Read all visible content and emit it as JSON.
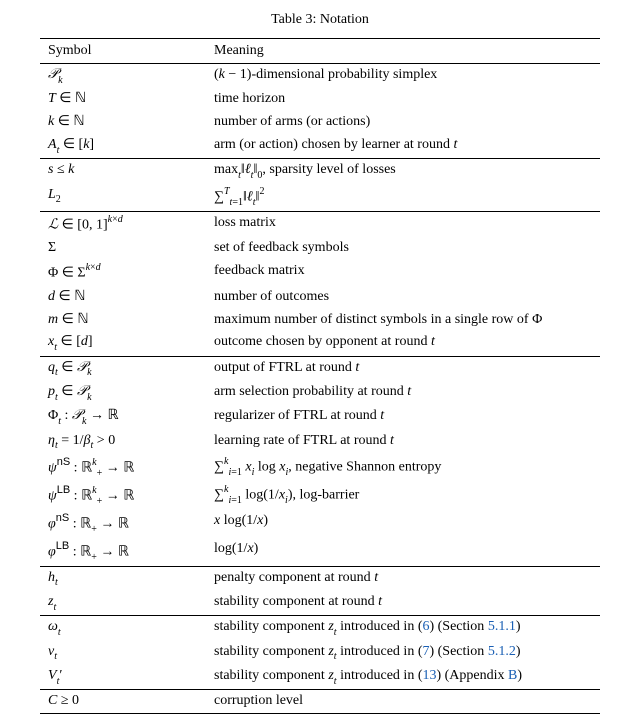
{
  "caption": "Table 3:  Notation",
  "header": {
    "symbol": "Symbol",
    "meaning": "Meaning"
  },
  "groups": [
    [
      {
        "sym": "<span class='cal'>𝒫</span><span class='sub'><span class='math'>k</span></span>",
        "mean": "(<span class='math'>k</span> − 1)-dimensional probability simplex"
      },
      {
        "sym": "<span class='math'>T</span> ∈ <span class='bb'>ℕ</span>",
        "mean": "time horizon"
      },
      {
        "sym": "<span class='math'>k</span> ∈ <span class='bb'>ℕ</span>",
        "mean": "number of arms (or actions)"
      },
      {
        "sym": "<span class='math'>A</span><span class='sub'><span class='math'>t</span></span> ∈ [<span class='math'>k</span>]",
        "mean": "arm (or action) chosen by learner at round <span class='math'>t</span>"
      }
    ],
    [
      {
        "sym": "<span class='math'>s</span> ≤ <span class='math'>k</span>",
        "mean": "max<span class='sub'><span class='math'>t</span></span>‖<span class='math'>ℓ</span><span class='sub'><span class='math'>t</span></span>‖<span class='sub'>0</span>, sparsity level of losses"
      },
      {
        "sym": "<span class='math'>L</span><span class='sub'>2</span>",
        "mean": "∑<span class='sup'><span class='math'>T</span></span><span class='sub'><span class='math'>t</span>=1</span>‖<span class='math'>ℓ</span><span class='sub'><span class='math'>t</span></span>‖<span class='sup'>2</span>"
      }
    ],
    [
      {
        "sym": "<span class='cal'>ℒ</span> ∈ [0, 1]<span class='sup'><span class='math'>k</span>×<span class='math'>d</span></span>",
        "mean": "loss matrix"
      },
      {
        "sym": "Σ",
        "mean": "set of feedback symbols"
      },
      {
        "sym": "Φ ∈ Σ<span class='sup'><span class='math'>k</span>×<span class='math'>d</span></span>",
        "mean": "feedback matrix"
      },
      {
        "sym": "<span class='math'>d</span> ∈ <span class='bb'>ℕ</span>",
        "mean": "number of outcomes"
      },
      {
        "sym": "<span class='math'>m</span> ∈ <span class='bb'>ℕ</span>",
        "mean": "maximum number of distinct symbols in a single row of Φ"
      },
      {
        "sym": "<span class='math'>x</span><span class='sub'><span class='math'>t</span></span> ∈ [<span class='math'>d</span>]",
        "mean": "outcome chosen by opponent at round <span class='math'>t</span>"
      }
    ],
    [
      {
        "sym": "<span class='math'>q</span><span class='sub'><span class='math'>t</span></span> ∈ <span class='cal'>𝒫</span><span class='sub'><span class='math'>k</span></span>",
        "mean": "output of FTRL at round <span class='math'>t</span>"
      },
      {
        "sym": "<span class='math'>p</span><span class='sub'><span class='math'>t</span></span> ∈ <span class='cal'>𝒫</span><span class='sub'><span class='math'>k</span></span>",
        "mean": "arm selection probability at round <span class='math'>t</span>"
      },
      {
        "sym": "Φ<span class='sub'><span class='math'>t</span></span> : <span class='cal'>𝒫</span><span class='sub'><span class='math'>k</span></span> → <span class='bb'>ℝ</span>",
        "mean": "regularizer of FTRL at round <span class='math'>t</span>"
      },
      {
        "sym": "<span class='math'>η</span><span class='sub'><span class='math'>t</span></span> = 1/<span class='math'>β</span><span class='sub'><span class='math'>t</span></span> &gt; 0",
        "mean": "learning rate of FTRL at round <span class='math'>t</span>"
      },
      {
        "sym": "<span class='math'>ψ</span><span class='sup'><span class='sf'>nS</span></span> : <span class='bb'>ℝ</span><span class='sup'><span class='math'>k</span></span><span class='sub'>+</span> → <span class='bb'>ℝ</span>",
        "mean": "∑<span class='sup'><span class='math'>k</span></span><span class='sub'><span class='math'>i</span>=1</span> <span class='math'>x</span><span class='sub'><span class='math'>i</span></span> log <span class='math'>x</span><span class='sub'><span class='math'>i</span></span>, negative Shannon entropy"
      },
      {
        "sym": "<span class='math'>ψ</span><span class='sup'><span class='sf'>LB</span></span> : <span class='bb'>ℝ</span><span class='sup'><span class='math'>k</span></span><span class='sub'>+</span> → <span class='bb'>ℝ</span>",
        "mean": "∑<span class='sup'><span class='math'>k</span></span><span class='sub'><span class='math'>i</span>=1</span> log(1/<span class='math'>x</span><span class='sub'><span class='math'>i</span></span>), log-barrier"
      },
      {
        "sym": "<span class='math'>φ</span><span class='sup'><span class='sf'>nS</span></span> : <span class='bb'>ℝ</span><span class='sub'>+</span> → <span class='bb'>ℝ</span>",
        "mean": "<span class='math'>x</span> log(1/<span class='math'>x</span>)"
      },
      {
        "sym": "<span class='math'>φ</span><span class='sup'><span class='sf'>LB</span></span> : <span class='bb'>ℝ</span><span class='sub'>+</span> → <span class='bb'>ℝ</span>",
        "mean": "log(1/<span class='math'>x</span>)"
      }
    ],
    [
      {
        "sym": "<span class='math'>h</span><span class='sub'><span class='math'>t</span></span>",
        "mean": "penalty component at round <span class='math'>t</span>"
      },
      {
        "sym": "<span class='math'>z</span><span class='sub'><span class='math'>t</span></span>",
        "mean": "stability component at round <span class='math'>t</span>"
      }
    ],
    [
      {
        "sym": "<span class='math'>ω</span><span class='sub'><span class='math'>t</span></span>",
        "mean": "stability component <span class='math'>z</span><span class='sub'><span class='math'>t</span></span> introduced in (<a class='ref' href='#'>6</a>) (Section <a class='ref' href='#'>5.1.1</a>)"
      },
      {
        "sym": "<span class='math'>ν</span><span class='sub'><span class='math'>t</span></span>",
        "mean": "stability component <span class='math'>z</span><span class='sub'><span class='math'>t</span></span> introduced in (<a class='ref' href='#'>7</a>) (Section <a class='ref' href='#'>5.1.2</a>)"
      },
      {
        "sym": "<span class='math'>V</span><span class='sub'><span class='math'>t</span></span>′",
        "mean": "stability component <span class='math'>z</span><span class='sub'><span class='math'>t</span></span> introduced in (<a class='ref' href='#'>13</a>) (Appendix <a class='ref' href='#'>B</a>)"
      }
    ],
    [
      {
        "sym": "<span class='math'>C</span> ≥ 0",
        "mean": "corruption level"
      }
    ]
  ]
}
